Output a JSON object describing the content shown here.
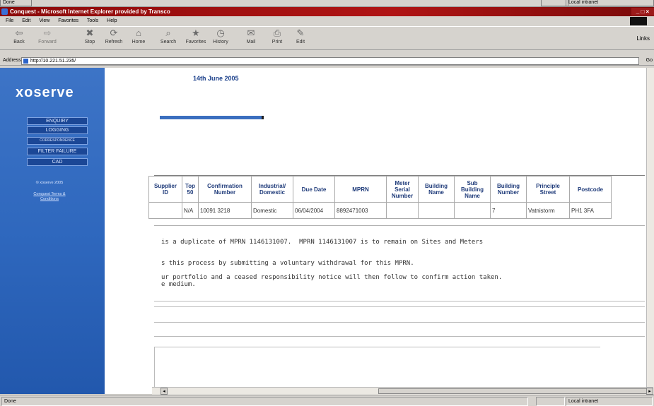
{
  "top_status": {
    "left": "Done",
    "right": "Local intranet"
  },
  "window": {
    "title": "Conquest - Microsoft Internet Explorer provided by Transco",
    "controls": "_ □ ×"
  },
  "menu": [
    "File",
    "Edit",
    "View",
    "Favorites",
    "Tools",
    "Help"
  ],
  "toolbar": {
    "buttons": [
      {
        "label": "Back",
        "icon": "back-arrow-icon",
        "glyph": "⇦"
      },
      {
        "label": "Forward",
        "icon": "forward-arrow-icon",
        "glyph": "⇨"
      },
      {
        "label": "Stop",
        "icon": "stop-icon",
        "glyph": "✖"
      },
      {
        "label": "Refresh",
        "icon": "refresh-icon",
        "glyph": "⟳"
      },
      {
        "label": "Home",
        "icon": "home-icon",
        "glyph": "⌂"
      },
      {
        "label": "Search",
        "icon": "search-icon",
        "glyph": "⌕"
      },
      {
        "label": "Favorites",
        "icon": "favorites-icon",
        "glyph": "★"
      },
      {
        "label": "History",
        "icon": "history-icon",
        "glyph": "◷"
      },
      {
        "label": "Mail",
        "icon": "mail-icon",
        "glyph": "✉"
      },
      {
        "label": "Print",
        "icon": "print-icon",
        "glyph": "⎙"
      },
      {
        "label": "Edit",
        "icon": "edit-icon",
        "glyph": "✎"
      }
    ],
    "links": "Links"
  },
  "address": {
    "label": "Address",
    "url": "http://10.221.51.235/",
    "go": "Go"
  },
  "sidebar": {
    "logo": "xoserve",
    "nav": [
      "ENQUIRY",
      "LOGGING",
      "CORRESPONDENCE",
      "FILTER FAILURE",
      "CAD"
    ],
    "copyright": "© xoserve 2005",
    "terms": "Conquest Terms & Conditions"
  },
  "content": {
    "date": "14th June 2005",
    "table": {
      "headers": [
        "Supplier ID",
        "Top 50",
        "Confirmation Number",
        "Industrial/ Domestic",
        "Due Date",
        "MPRN",
        "Meter Serial Number",
        "Building Name",
        "Sub Building Name",
        "Building Number",
        "Principle Street",
        "Postcode"
      ],
      "rows": [
        [
          "",
          "N/A",
          "10091 3218",
          "Domestic",
          "06/04/2004",
          "8892471003",
          "",
          "",
          "",
          "7",
          "Vatnistorm",
          "PH1 3FA"
        ]
      ]
    },
    "messages": [
      "is a duplicate of MPRN 1146131007.  MPRN 1146131007 is to remain on Sites and Meters",
      "s this process by submitting a voluntary withdrawal for this MPRN.",
      "ur portfolio and a ceased responsibility notice will then follow to confirm action taken.",
      "e medium."
    ]
  },
  "bottom_status": {
    "left": "Done",
    "right": "Local intranet"
  }
}
